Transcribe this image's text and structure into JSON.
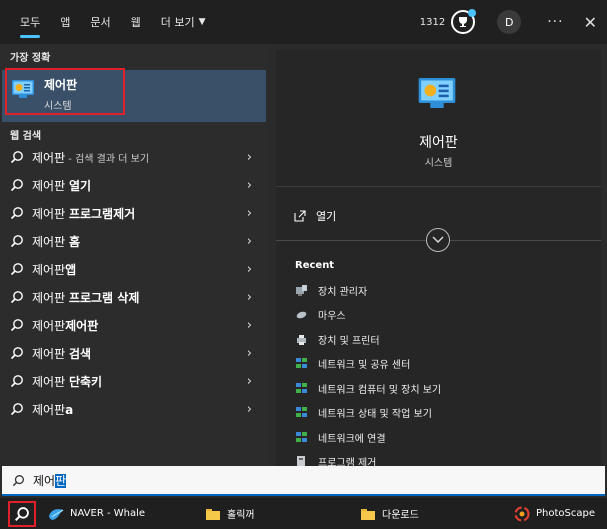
{
  "header": {
    "tabs": [
      {
        "label": "모두",
        "active": true
      },
      {
        "label": "앱"
      },
      {
        "label": "문서"
      },
      {
        "label": "웹"
      },
      {
        "label": "더 보기"
      }
    ],
    "points": "1312",
    "avatar_letter": "D",
    "more": "···",
    "close": "✕"
  },
  "best_match": {
    "section": "가장 정확",
    "title": "제어판",
    "subtitle": "시스템"
  },
  "web_search": {
    "section": "웹 검색",
    "results": [
      {
        "prefix": "제어판",
        "bold": "",
        "dim": " - 검색 결과 더 보기"
      },
      {
        "prefix": "제어판 ",
        "bold": "열기",
        "dim": ""
      },
      {
        "prefix": "제어판 ",
        "bold": "프로그램제거",
        "dim": ""
      },
      {
        "prefix": "제어판 ",
        "bold": "홈",
        "dim": ""
      },
      {
        "prefix": "제어판",
        "bold": "앱",
        "dim": ""
      },
      {
        "prefix": "제어판 ",
        "bold": "프로그램 삭제",
        "dim": ""
      },
      {
        "prefix": "제어판",
        "bold": "제어판",
        "dim": ""
      },
      {
        "prefix": "제어판 ",
        "bold": "검색",
        "dim": ""
      },
      {
        "prefix": "제어판 ",
        "bold": "단축키",
        "dim": ""
      },
      {
        "prefix": "제어판",
        "bold": "a",
        "dim": ""
      }
    ]
  },
  "detail": {
    "title": "제어판",
    "subtitle": "시스템",
    "open_label": "열기",
    "recent_label": "Recent",
    "recent": [
      {
        "label": "장치 관리자",
        "icon": "device-manager-icon"
      },
      {
        "label": "마우스",
        "icon": "mouse-icon"
      },
      {
        "label": "장치 및 프린터",
        "icon": "printer-icon"
      },
      {
        "label": "네트워크 및 공유 센터",
        "icon": "network-icon"
      },
      {
        "label": "네트워크 컴퓨터 및 장치 보기",
        "icon": "network-icon"
      },
      {
        "label": "네트워크 상태 및 작업 보기",
        "icon": "network-icon"
      },
      {
        "label": "네트워크에 연결",
        "icon": "network-icon"
      },
      {
        "label": "프로그램 제거",
        "icon": "programs-icon"
      }
    ]
  },
  "search": {
    "query_plain": "제어",
    "query_selected": "판"
  },
  "taskbar": {
    "items": [
      {
        "label": "NAVER - Whale"
      },
      {
        "label": "홀릭꺼"
      },
      {
        "label": "다운로드"
      },
      {
        "label": "PhotoScape"
      }
    ]
  },
  "colors": {
    "accent": "#4cc2ff",
    "selection": "#3a5068",
    "highlight_box": "#e0202a",
    "search_underline": "#0067c0"
  }
}
